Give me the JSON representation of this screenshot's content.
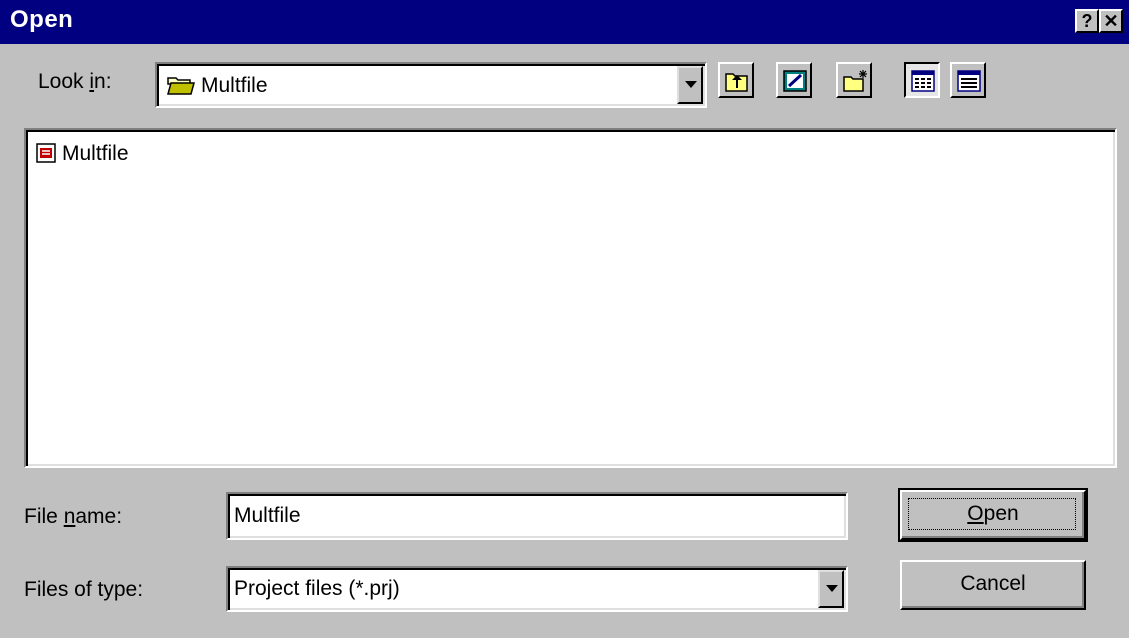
{
  "window": {
    "title": "Open",
    "help_label": "?",
    "close_label": "✕"
  },
  "look_in": {
    "label_pre": "Look ",
    "label_accel": "i",
    "label_post": "n:",
    "value": "Multfile",
    "icon": "folder-open-icon"
  },
  "toolbar": {
    "up_icon": "up-one-level-icon",
    "desktop_icon": "desktop-icon",
    "new_folder_icon": "new-folder-icon",
    "list_icon": "list-view-icon",
    "details_icon": "details-view-icon"
  },
  "files": [
    {
      "name": "Multfile",
      "icon": "project-file-icon"
    }
  ],
  "file_name": {
    "label_pre": "File ",
    "label_accel": "n",
    "label_post": "ame:",
    "value": "Multfile"
  },
  "file_type": {
    "label": "Files of type:",
    "value": "Project files (*.prj)"
  },
  "buttons": {
    "open_accel": "O",
    "open_rest": "pen",
    "cancel": "Cancel"
  },
  "colors": {
    "titlebar": "#000080",
    "face": "#c0c0c0",
    "window": "#ffffff"
  }
}
